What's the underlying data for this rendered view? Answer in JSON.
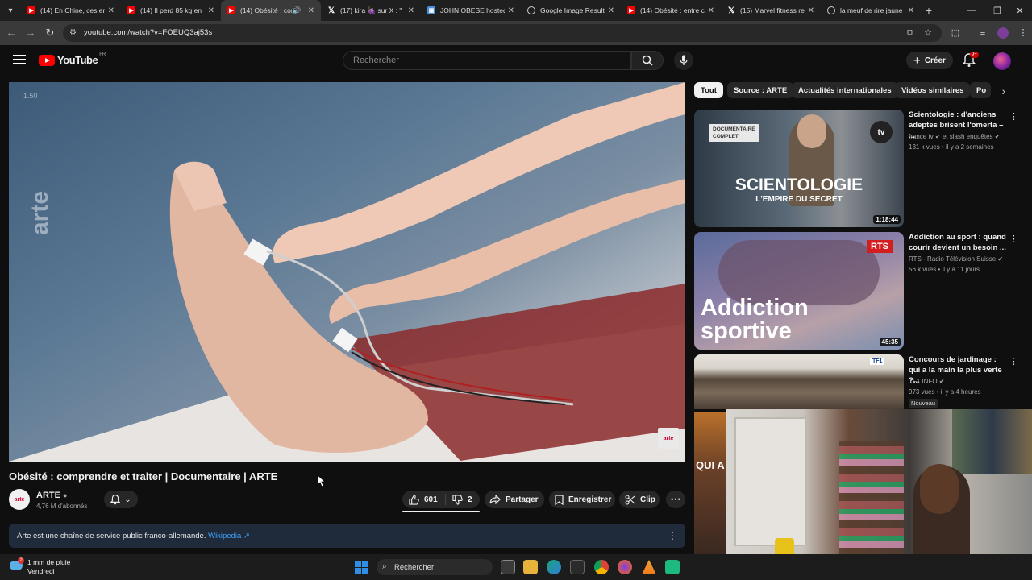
{
  "tabs": [
    {
      "title": "(14) En Chine, ces en",
      "favicon": "youtube-icon",
      "active": false
    },
    {
      "title": "(14) Il perd 85 kg en",
      "favicon": "youtube-icon",
      "active": false
    },
    {
      "title": "(14) Obésité : com",
      "favicon": "youtube-icon",
      "active": true
    },
    {
      "title": "(17) kira 🍇 sur X : \"",
      "favicon": "x-icon",
      "active": false
    },
    {
      "title": "JOHN OBESE hosted",
      "favicon": "image-icon",
      "active": false
    },
    {
      "title": "Google Image Result",
      "favicon": "globe-icon",
      "active": false
    },
    {
      "title": "(14) Obésité : entre c",
      "favicon": "youtube-icon",
      "active": false
    },
    {
      "title": "(15) Marvel fitness re",
      "favicon": "x-icon",
      "active": false
    },
    {
      "title": "la meuf de rire jaune",
      "favicon": "globe-icon",
      "active": false
    }
  ],
  "address": {
    "url": "youtube.com/watch?v=FOEUQ3aj53s"
  },
  "youtube": {
    "logo_text": "YouTube",
    "logo_country": "FR",
    "search_placeholder": "Rechercher",
    "create_label": "Créer",
    "notif_badge": "9+"
  },
  "player": {
    "watermark": "arte",
    "speed_label": "1.50",
    "corner_badge": "arte"
  },
  "video": {
    "title": "Obésité : comprendre et traiter | Documentaire | ARTE",
    "channel_avatar_text": "arte",
    "channel": "ARTE",
    "subscribers": "4,76 M d'abonnés",
    "likes": "601",
    "dislikes": "2",
    "share_label": "Partager",
    "save_label": "Enregistrer",
    "clip_label": "Clip",
    "description": "Arte est une chaîne de service public franco-allemande.",
    "description_link": "Wikipedia ↗"
  },
  "chips": [
    "Tout",
    "Source : ARTE",
    "Actualités internationales",
    "Vidéos similaires",
    "Po"
  ],
  "recommendations": [
    {
      "title": "Scientologie : d'anciens adeptes brisent l'omerta – ...",
      "channel": "france tv ✔ et slash enquêtes ✔",
      "meta": "131 k vues • il y a 2 semaines",
      "duration": "1:18:44",
      "thumb_caption_small1": "DOCUMENTAIRE",
      "thumb_caption_small2": "COMPLET",
      "thumb_caption_big": "SCIENTOLOGIE",
      "thumb_caption_sub": "L'EMPIRE DU SECRET",
      "thumb_logo": "tv"
    },
    {
      "title": "Addiction au sport : quand courir devient un besoin ...",
      "channel": "RTS - Radio Télévision Suisse ✔",
      "meta": "56 k vues • il y a 11 jours",
      "duration": "45:35",
      "thumb_caption_big": "Addiction sportive",
      "thumb_logo": "RTS"
    },
    {
      "title": "Concours de jardinage : qui a la main la plus verte ?...",
      "channel": "TF1 INFO ✔",
      "meta": "973 vues • il y a 4 heures",
      "badge": "Nouveau",
      "thumb_logo": "TF1"
    }
  ],
  "partial_thumb_text": "QUI A",
  "taskbar": {
    "weather_line1": "1 mm de pluie",
    "weather_line2": "Vendredi",
    "weather_badge": "2",
    "search_label": "Rechercher"
  },
  "colors": {
    "yt_red": "#ff0000",
    "link_blue": "#3ea6ff",
    "bg": "#0f0f0f"
  }
}
